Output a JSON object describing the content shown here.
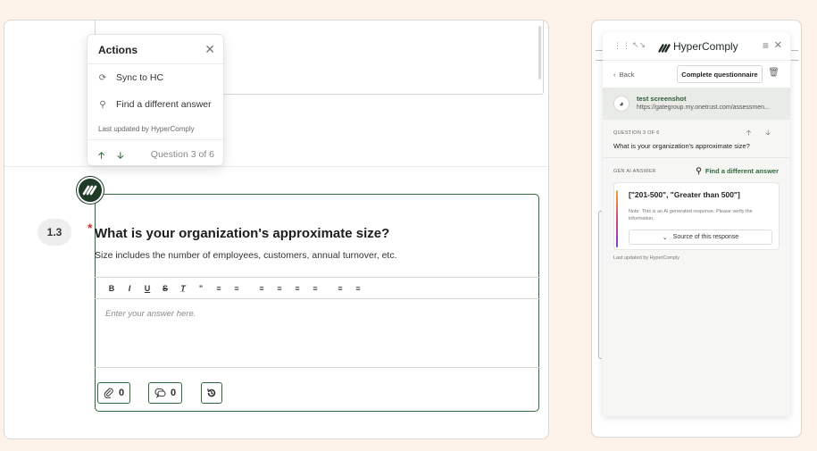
{
  "questionnaire": {
    "question_number": "1.3",
    "required_marker": "*",
    "question_title": "What is your organization's approximate size?",
    "question_description": "Size includes the number of employees, customers, annual turnover, etc.",
    "editor_placeholder": "Enter your answer here.",
    "toolbar": [
      "B",
      "I",
      "U",
      "S",
      "Tx",
      "”",
      "ol",
      "ul",
      "left",
      "center",
      "right",
      "justify",
      "outdent",
      "indent"
    ],
    "attachments_count": "0",
    "comments_count": "0",
    "colors": {
      "accent": "#2f6a3a",
      "required": "#d0342c"
    }
  },
  "actions_popover": {
    "title": "Actions",
    "items": [
      {
        "label": "Sync to HC",
        "icon": "sync-icon"
      },
      {
        "label": "Find a different answer",
        "icon": "search-icon"
      }
    ],
    "last_updated": "Last updated by HyperComply",
    "counter": "Question 3 of 6"
  },
  "side_panel": {
    "brand": "HyperComply",
    "back_label": "Back",
    "complete_label": "Complete questionnaire",
    "source": {
      "title": "test screenshot",
      "url": "https://gategroup.my.onetrust.com/assessmen..."
    },
    "question_label": "QUESTION 3 OF 6",
    "question_text": "What is your organization's approximate size?",
    "gen_ai_label": "GEN AI ANSWER",
    "find_different": "Find a different answer",
    "answer": "[\"201-500\", \"Greater than 500\"]",
    "note": "Note: This is an AI generated response. Please verify the information.",
    "source_button": "Source of this response",
    "last_updated": "Last updated by HyperComply"
  }
}
